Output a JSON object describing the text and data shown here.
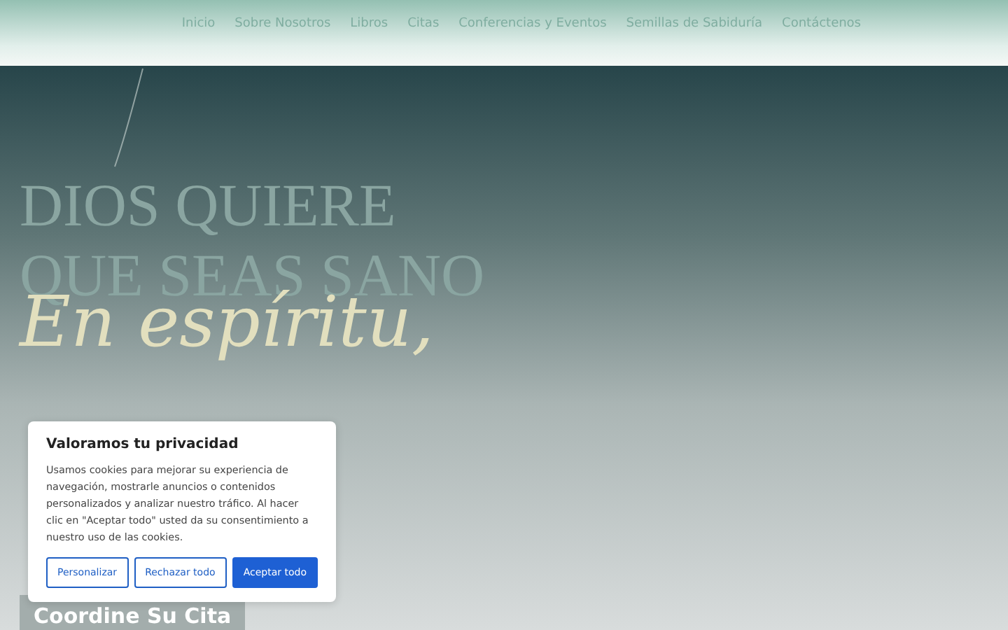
{
  "nav": {
    "items": [
      {
        "label": "Inicio"
      },
      {
        "label": "Sobre Nosotros"
      },
      {
        "label": "Libros"
      },
      {
        "label": "Citas"
      },
      {
        "label": "Conferencias y Eventos"
      },
      {
        "label": "Semillas de Sabiduría"
      },
      {
        "label": "Contáctenos"
      }
    ]
  },
  "hero": {
    "heading_lines": [
      "DIOS QUIERE",
      "QUE SEAS SANO"
    ],
    "script_lines": [
      "En espíritu,"
    ],
    "cta": "Coordine Su Cita"
  },
  "cookie_dialog": {
    "title": "Valoramos tu privacidad",
    "text": "Usamos cookies para mejorar su experiencia de navegación, mostrarle anuncios o contenidos personalizados y analizar nuestro tráfico. Al hacer clic en \"Aceptar todo\" usted da su consentimiento a nuestro uso de las cookies.",
    "buttons": [
      {
        "label": "Personalizar",
        "kind": "outline"
      },
      {
        "label": "Rechazar todo",
        "kind": "outline"
      },
      {
        "label": "Aceptar todo",
        "kind": "primary"
      }
    ]
  }
}
